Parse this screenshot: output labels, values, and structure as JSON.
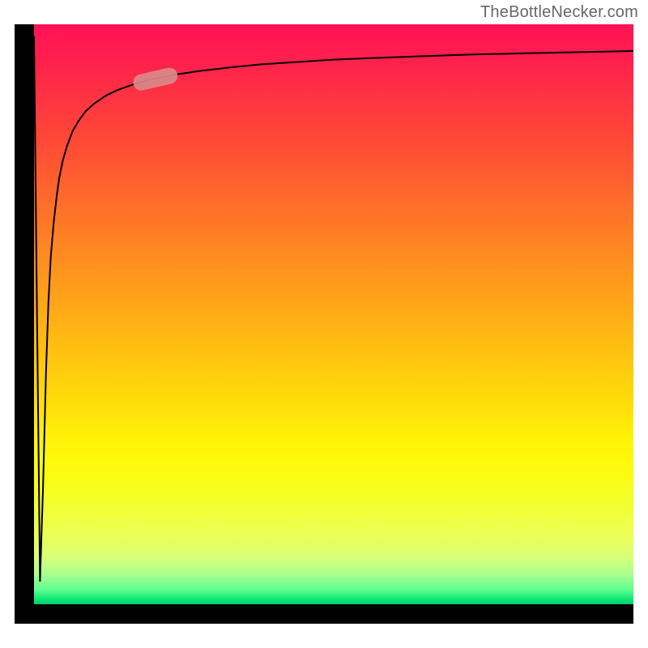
{
  "watermark": "TheBottleNecker.com",
  "colors": {
    "axis": "#000000",
    "marker": "#d98989",
    "gradient_top": "#ff1255",
    "gradient_bottom": "#00d06a"
  },
  "chart_data": {
    "type": "line",
    "title": "",
    "xlabel": "",
    "ylabel": "",
    "xlim": [
      0,
      100
    ],
    "ylim": [
      0,
      100
    ],
    "x": [
      0,
      0.5,
      1.0,
      1.5,
      2.0,
      2.4,
      2.8,
      3.3,
      3.8,
      4.2,
      4.8,
      5.5,
      6.4,
      7.4,
      8.6,
      10.0,
      12.0,
      14.0,
      17.0,
      20.0,
      24.0,
      28.0,
      33.0,
      38.0,
      44.0,
      50.0,
      57.0,
      65.0,
      73.0,
      82.0,
      91.0,
      100.0
    ],
    "values": [
      98.0,
      50.0,
      4.0,
      20.0,
      40.0,
      52.0,
      60.0,
      66.0,
      70.5,
      73.5,
      76.5,
      79.0,
      81.5,
      83.3,
      85.0,
      86.3,
      87.7,
      88.7,
      89.8,
      90.6,
      91.4,
      92.0,
      92.6,
      93.1,
      93.5,
      93.9,
      94.2,
      94.5,
      94.8,
      95.0,
      95.2,
      95.4
    ],
    "marker_segment": {
      "x_start": 17.5,
      "x_end": 23.0,
      "y_start": 89.9,
      "y_end": 91.2
    },
    "annotations": []
  }
}
